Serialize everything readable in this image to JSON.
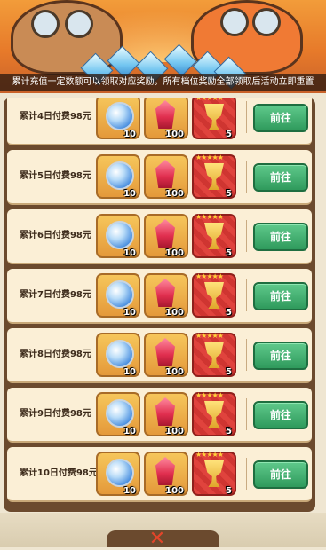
{
  "notice_text": "累计充值一定数额可以领取对应奖励，所有档位奖励全部领取后活动立即重置",
  "rows": [
    {
      "title": "累计4日付费98元",
      "orb_qty": "10",
      "ruby_qty": "100",
      "trophy_qty": "5",
      "button": "前往"
    },
    {
      "title": "累计5日付费98元",
      "orb_qty": "10",
      "ruby_qty": "100",
      "trophy_qty": "5",
      "button": "前往"
    },
    {
      "title": "累计6日付费98元",
      "orb_qty": "10",
      "ruby_qty": "100",
      "trophy_qty": "5",
      "button": "前往"
    },
    {
      "title": "累计7日付费98元",
      "orb_qty": "10",
      "ruby_qty": "100",
      "trophy_qty": "5",
      "button": "前往"
    },
    {
      "title": "累计8日付费98元",
      "orb_qty": "10",
      "ruby_qty": "100",
      "trophy_qty": "5",
      "button": "前往"
    },
    {
      "title": "累计9日付费98元",
      "orb_qty": "10",
      "ruby_qty": "100",
      "trophy_qty": "5",
      "button": "前往"
    },
    {
      "title": "累计10日付费98元",
      "orb_qty": "10",
      "ruby_qty": "100",
      "trophy_qty": "5",
      "button": "前往"
    }
  ],
  "trophy_stars": "★★★★★",
  "icons": {
    "reward_1": "crystal-orb-icon",
    "reward_2": "ruby-gem-icon",
    "reward_3": "gold-trophy-icon",
    "close": "close-icon"
  },
  "colors": {
    "go_button": "#2f9a5c",
    "frame": "#6b4a2e",
    "row_bg": "#fbefd6"
  }
}
